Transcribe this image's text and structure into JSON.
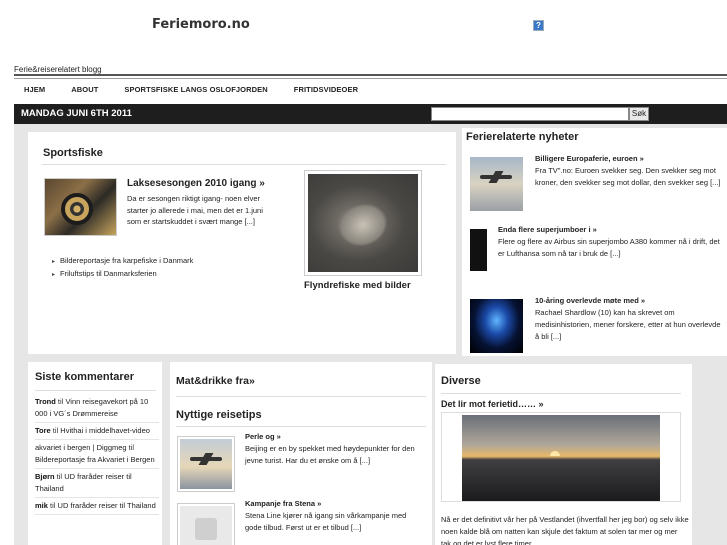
{
  "site": {
    "title": "Feriemoro.no",
    "tagline": "Ferie&reiserelatert blogg",
    "broken_image_glyph": "?"
  },
  "nav": {
    "items": [
      "HJEM",
      "ABOUT",
      "SPORTSFISKE LANGS OSLOFJORDEN",
      "FRITIDSVIDEOER"
    ]
  },
  "datebar": {
    "date": "MANDAG JUNI 6TH 2011",
    "search_value": "",
    "search_button": "Søk"
  },
  "featured": {
    "heading": "Sportsfiske",
    "post_title": "Laksesesongen 2010 igang »",
    "post_text": "Da er sesongen riktigt igang- noen elver starter jo allerede i mai, men det er 1.juni som er startskuddet i svært mange [...]",
    "links": [
      "Bildereportasje fra karpefiske i Danmark",
      "Friluftstips til Danmarksferien"
    ],
    "big_caption": "Flyndrefiske med bilder"
  },
  "news": {
    "heading": "Ferierelaterte nyheter",
    "items": [
      {
        "title": "Billigere Europaferie, euroen »",
        "text": "Fra TV\".no: Euroen svekker seg. Den svekker seg mot kroner, den svekker seg mot dollar, den svekker seg [...]"
      },
      {
        "title": "Enda flere superjumboer i »",
        "text": "Flere og flere av Airbus sin superjombo A380 kommer nå i drift, det er Lufthansa som nå tar i bruk de [...]"
      },
      {
        "title": "10-åring overlevde møte med »",
        "text": "Rachael Shardlow (10) kan ha skrevet om medisinhistorien, mener forskere, etter at hun overlevde å bli [...]"
      }
    ]
  },
  "comments": {
    "heading": "Siste kommentarer",
    "items": [
      {
        "author": "Trond",
        "sep": " til ",
        "post": "Vinn reisegavekort på 10 000 i VG´s Drømmereise"
      },
      {
        "author": "Tore",
        "sep": " til ",
        "post": "Hvithai i middelhavet-video"
      },
      {
        "author": "akvariet i bergen | Diggmeg",
        "sep": " til ",
        "post": "Bildereportasje fra Akvariet i Bergen"
      },
      {
        "author": "Bjørn",
        "sep": " til ",
        "post": "UD fraråder reiser til Thailand"
      },
      {
        "author": "mik",
        "sep": " til ",
        "post": "UD fraråder reiser til Thailand"
      }
    ]
  },
  "mat": {
    "heading": "Mat&drikke fra»",
    "heading2": "Nyttige reisetips",
    "items": [
      {
        "title": "Perle og »",
        "text": "Beijing er en by spekket med høydepunkter for den jevne turist. Har du et ønske om å [...]"
      },
      {
        "title": "Kampanje fra Stena »",
        "text": "Stena Line kjører nå igang sin vårkampanje med gode tilbud. Først ut er et tilbud [...]"
      }
    ]
  },
  "diverse": {
    "heading": "Diverse",
    "sub": "Det lir mot ferietid…… »",
    "text": "Nå er det definitivt vår her på Vestlandet (ihvertfall her jeg bor) og selv ikke noen kalde blå om natten kan skjule det faktum at solen tar mer og mer tak og det er lyst flere timer"
  }
}
